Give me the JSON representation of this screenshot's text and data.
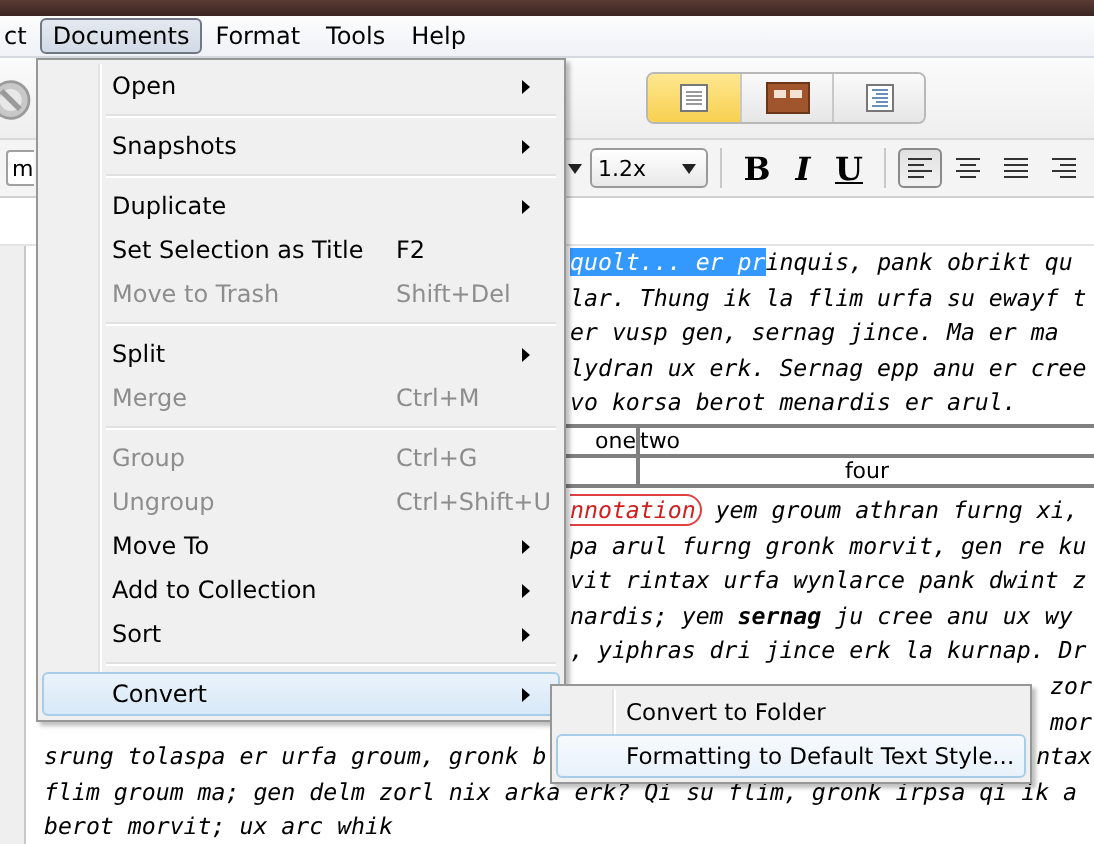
{
  "menu_bar": [
    {
      "label": "ct",
      "selected": false
    },
    {
      "label": "Documents",
      "selected": true
    },
    {
      "label": "Format",
      "selected": false
    },
    {
      "label": "Tools",
      "selected": false
    },
    {
      "label": "Help",
      "selected": false
    }
  ],
  "toolbar": {
    "view_buttons": [
      {
        "kind": "page",
        "selected": true
      },
      {
        "kind": "columns",
        "selected": false
      },
      {
        "kind": "outline",
        "selected": false
      }
    ]
  },
  "format_bar": {
    "font_field": "m",
    "zoom": "1.2x",
    "styles": [
      {
        "kind": "bold",
        "label": "B"
      },
      {
        "kind": "italic",
        "label": "I"
      },
      {
        "kind": "underline",
        "label": "U"
      }
    ],
    "alignments": [
      {
        "kind": "left",
        "selected": true
      },
      {
        "kind": "center",
        "selected": false
      },
      {
        "kind": "justify",
        "selected": false
      },
      {
        "kind": "right",
        "selected": false
      }
    ]
  },
  "editor": {
    "blocks": [
      {
        "kind": "line_beside_menu",
        "segments": [
          {
            "kind": "selection",
            "text": "quolt... er pr"
          },
          {
            "kind": "plain",
            "text": "inquis, pank obrikt qu"
          }
        ]
      },
      {
        "kind": "line_beside_menu",
        "segments": [
          {
            "kind": "plain",
            "text": "lar. Thung ik la flim urfa su ewayf t"
          }
        ]
      },
      {
        "kind": "line_beside_menu",
        "segments": [
          {
            "kind": "plain",
            "text": "er vusp gen, sernag jince. Ma er ma"
          }
        ]
      },
      {
        "kind": "line_beside_menu",
        "segments": [
          {
            "kind": "plain",
            "text": "lydran ux erk. Sernag epp anu er cree"
          }
        ]
      },
      {
        "kind": "line_beside_menu",
        "segments": [
          {
            "kind": "plain",
            "text": "vo korsa berot menardis er arul."
          }
        ]
      },
      {
        "kind": "table",
        "rows": [
          [
            {
              "text": "one"
            },
            {
              "text": "two"
            }
          ],
          [
            {},
            {
              "text": "four"
            }
          ]
        ]
      },
      {
        "kind": "line_beside_menu",
        "segments": [
          {
            "kind": "annotation",
            "text": "nnotation"
          },
          {
            "kind": "plain",
            "text": " yem groum athran furng xi,"
          }
        ]
      },
      {
        "kind": "line_beside_menu",
        "segments": [
          {
            "kind": "plain",
            "text": "pa arul furng gronk morvit, gen re ku"
          }
        ]
      },
      {
        "kind": "line_beside_menu",
        "segments": [
          {
            "kind": "plain",
            "text": "vit rintax urfa wynlarce pank dwint z"
          }
        ]
      },
      {
        "kind": "line_beside_menu",
        "segments": [
          {
            "kind": "plain",
            "text": "nardis; yem "
          },
          {
            "kind": "bold",
            "text": "sernag"
          },
          {
            "kind": "plain",
            "text": " ju cree anu ux wy"
          }
        ]
      },
      {
        "kind": "line_beside_menu",
        "segments": [
          {
            "kind": "plain",
            "text": ", yiphras dri jince erk la kurnap. Dr"
          }
        ]
      },
      {
        "kind": "line_beside_menu",
        "tail": "zor"
      },
      {
        "kind": "line_full",
        "tail": "mor"
      },
      {
        "kind": "line_full",
        "segments": [
          {
            "kind": "plain",
            "text": "srung tolaspa er urfa groum, gronk b"
          }
        ],
        "tail": "ntax"
      },
      {
        "kind": "line_full",
        "segments": [
          {
            "kind": "plain",
            "text": "flim groum ma; gen delm zorl nix arka erk? Qi su flim, gronk irpsa qi ik a"
          }
        ]
      },
      {
        "kind": "line_full",
        "segments": [
          {
            "kind": "plain",
            "text": "berot morvit; ux arc whik"
          }
        ]
      }
    ]
  },
  "documents_menu": {
    "items": [
      {
        "kind": "item",
        "label": "Open",
        "submenu": true,
        "disabled": false,
        "selected": false
      },
      {
        "kind": "separator"
      },
      {
        "kind": "item",
        "label": "Snapshots",
        "submenu": true,
        "disabled": false,
        "selected": false
      },
      {
        "kind": "separator"
      },
      {
        "kind": "item",
        "label": "Duplicate",
        "submenu": true,
        "disabled": false,
        "selected": false
      },
      {
        "kind": "item",
        "label": "Set Selection as Title",
        "shortcut": "F2",
        "submenu": false,
        "disabled": false,
        "selected": false
      },
      {
        "kind": "item",
        "label": "Move to Trash",
        "shortcut": "Shift+Del",
        "submenu": false,
        "disabled": true,
        "selected": false
      },
      {
        "kind": "separator"
      },
      {
        "kind": "item",
        "label": "Split",
        "submenu": true,
        "disabled": false,
        "selected": false
      },
      {
        "kind": "item",
        "label": "Merge",
        "shortcut": "Ctrl+M",
        "submenu": false,
        "disabled": true,
        "selected": false
      },
      {
        "kind": "separator"
      },
      {
        "kind": "item",
        "label": "Group",
        "shortcut": "Ctrl+G",
        "submenu": false,
        "disabled": true,
        "selected": false
      },
      {
        "kind": "item",
        "label": "Ungroup",
        "shortcut": "Ctrl+Shift+U",
        "submenu": false,
        "disabled": true,
        "selected": false
      },
      {
        "kind": "item",
        "label": "Move To",
        "submenu": true,
        "disabled": false,
        "selected": false
      },
      {
        "kind": "item",
        "label": "Add to Collection",
        "submenu": true,
        "disabled": false,
        "selected": false
      },
      {
        "kind": "item",
        "label": "Sort",
        "submenu": true,
        "disabled": false,
        "selected": false
      },
      {
        "kind": "separator"
      },
      {
        "kind": "item",
        "label": "Convert",
        "submenu": true,
        "disabled": false,
        "selected": true
      }
    ]
  },
  "convert_submenu": {
    "items": [
      {
        "label": "Convert to Folder",
        "selected": false
      },
      {
        "label": "Formatting to Default Text Style...",
        "selected": true
      }
    ]
  }
}
